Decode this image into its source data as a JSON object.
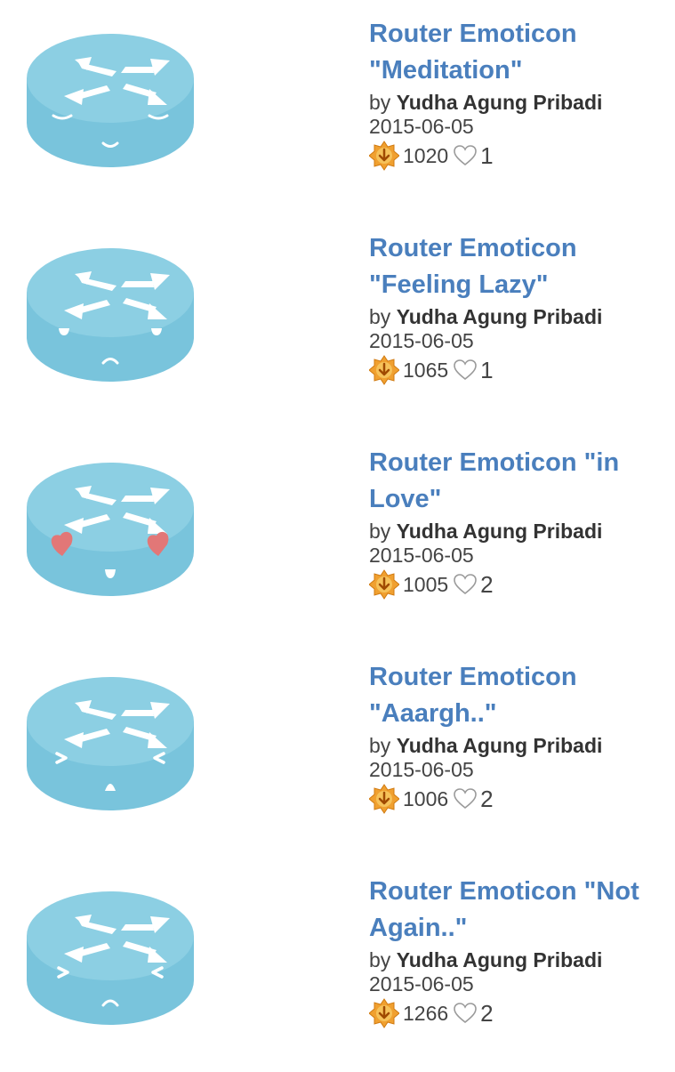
{
  "entries": [
    {
      "title_line1": "Router Emoticon",
      "title_line2": "\"Meditation\"",
      "by": "by",
      "author": "Yudha Agung Pribadi",
      "date": "2015-06-05",
      "downloads": "1020",
      "likes": "1",
      "face": "meditation"
    },
    {
      "title_line1": "Router Emoticon",
      "title_line2": "\"Feeling Lazy\"",
      "by": "by",
      "author": "Yudha Agung Pribadi",
      "date": "2015-06-05",
      "downloads": "1065",
      "likes": "1",
      "face": "lazy"
    },
    {
      "title_line1": "Router Emoticon \"in",
      "title_line2": "Love\"",
      "by": "by",
      "author": "Yudha Agung Pribadi",
      "date": "2015-06-05",
      "downloads": "1005",
      "likes": "2",
      "face": "love"
    },
    {
      "title_line1": "Router Emoticon",
      "title_line2": "\"Aaargh..\"",
      "by": "by",
      "author": "Yudha Agung Pribadi",
      "date": "2015-06-05",
      "downloads": "1006",
      "likes": "2",
      "face": "aaargh"
    },
    {
      "title_line1": "Router Emoticon \"Not",
      "title_line2": "Again..\"",
      "by": "by",
      "author": "Yudha Agung Pribadi",
      "date": "2015-06-05",
      "downloads": "1266",
      "likes": "2",
      "face": "notagain"
    }
  ],
  "colors": {
    "title_link": "#4a7fbd",
    "router_top": "#8ccfe3",
    "router_side": "#79c4dc",
    "heart_face": "#e27777"
  }
}
